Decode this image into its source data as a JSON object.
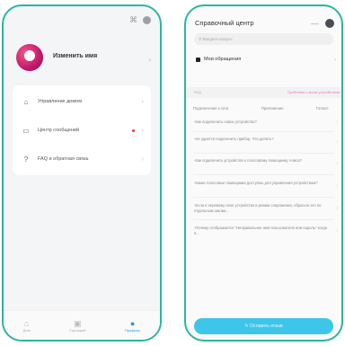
{
  "profile": {
    "edit_name": "Изменить имя"
  },
  "menu": [
    {
      "icon": "home-icon",
      "label": "Управление домом",
      "dot": false
    },
    {
      "icon": "message-icon",
      "label": "Центр сообщений",
      "dot": true
    },
    {
      "icon": "help-icon",
      "label": "FAQ и обратная связь",
      "dot": false
    }
  ],
  "tabbar": [
    {
      "label": "Дом",
      "icon": "home-tab-icon",
      "active": false
    },
    {
      "label": "Сценарий",
      "icon": "scene-tab-icon",
      "active": false
    },
    {
      "label": "Профиль",
      "icon": "profile-tab-icon",
      "active": true
    }
  ],
  "help": {
    "title": "Справочный центр",
    "search_placeholder": "Введите вопрос",
    "my_requests": "Мои обращения",
    "faq_label": "FAQ",
    "faq_link": "Проблемы с моим устройством",
    "categories": [
      "Подключение к сети",
      "Приложение",
      "Голосо"
    ],
    "questions": [
      "-Как подключить новое устройство?",
      "-Не удается подключить прибор. Что делать?",
      "-Как подключить устройство к голосовому помощнику Алиса?",
      "-Какие голосовые помощники доступны для управления устройством?",
      "-Если я перевожу свое устройство в режим сопряжения, сбросьте его по отдельным шагам...",
      "-Почему отображается \"Неправильное имя пользователя или пароль\" когда я..."
    ],
    "feedback_button": "Оставить отзыв"
  },
  "colors": {
    "accent": "#2bb5a0",
    "button": "#3ec6ea",
    "active_tab": "#1a9bde"
  }
}
